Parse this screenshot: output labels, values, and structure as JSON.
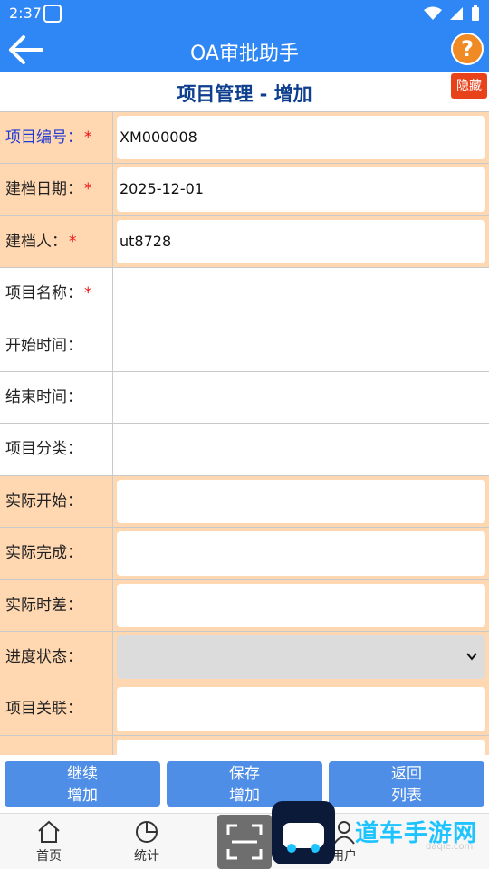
{
  "status": {
    "time": "2:37"
  },
  "app": {
    "title": "OA审批助手",
    "help": "?"
  },
  "page": {
    "title": "项目管理 - 增加",
    "hide_label": "隐藏"
  },
  "fields": [
    {
      "label": "项目编号：",
      "value": "XM000008",
      "required": true
    },
    {
      "label": "建档日期：",
      "value": "2025-12-01",
      "required": true
    },
    {
      "label": "建档人：",
      "value": "ut8728",
      "required": true
    },
    {
      "label": "项目名称：",
      "value": "",
      "required": true
    },
    {
      "label": "开始时间：",
      "value": ""
    },
    {
      "label": "结束时间：",
      "value": ""
    },
    {
      "label": "项目分类：",
      "value": ""
    },
    {
      "label": "实际开始：",
      "value": ""
    },
    {
      "label": "实际完成：",
      "value": ""
    },
    {
      "label": "实际时差：",
      "value": ""
    },
    {
      "label": "进度状态：",
      "value": ""
    },
    {
      "label": "项目关联：",
      "value": ""
    }
  ],
  "required_mark": "*",
  "actions": {
    "continue_line1": "继续",
    "continue_line2": "增加",
    "save_line1": "保存",
    "save_line2": "增加",
    "back_line1": "返回",
    "back_line2": "列表"
  },
  "tabs": {
    "home": "首页",
    "stats": "统计",
    "user": "用户"
  },
  "watermark": {
    "text": "道车手游网",
    "small": "daqie.com"
  }
}
